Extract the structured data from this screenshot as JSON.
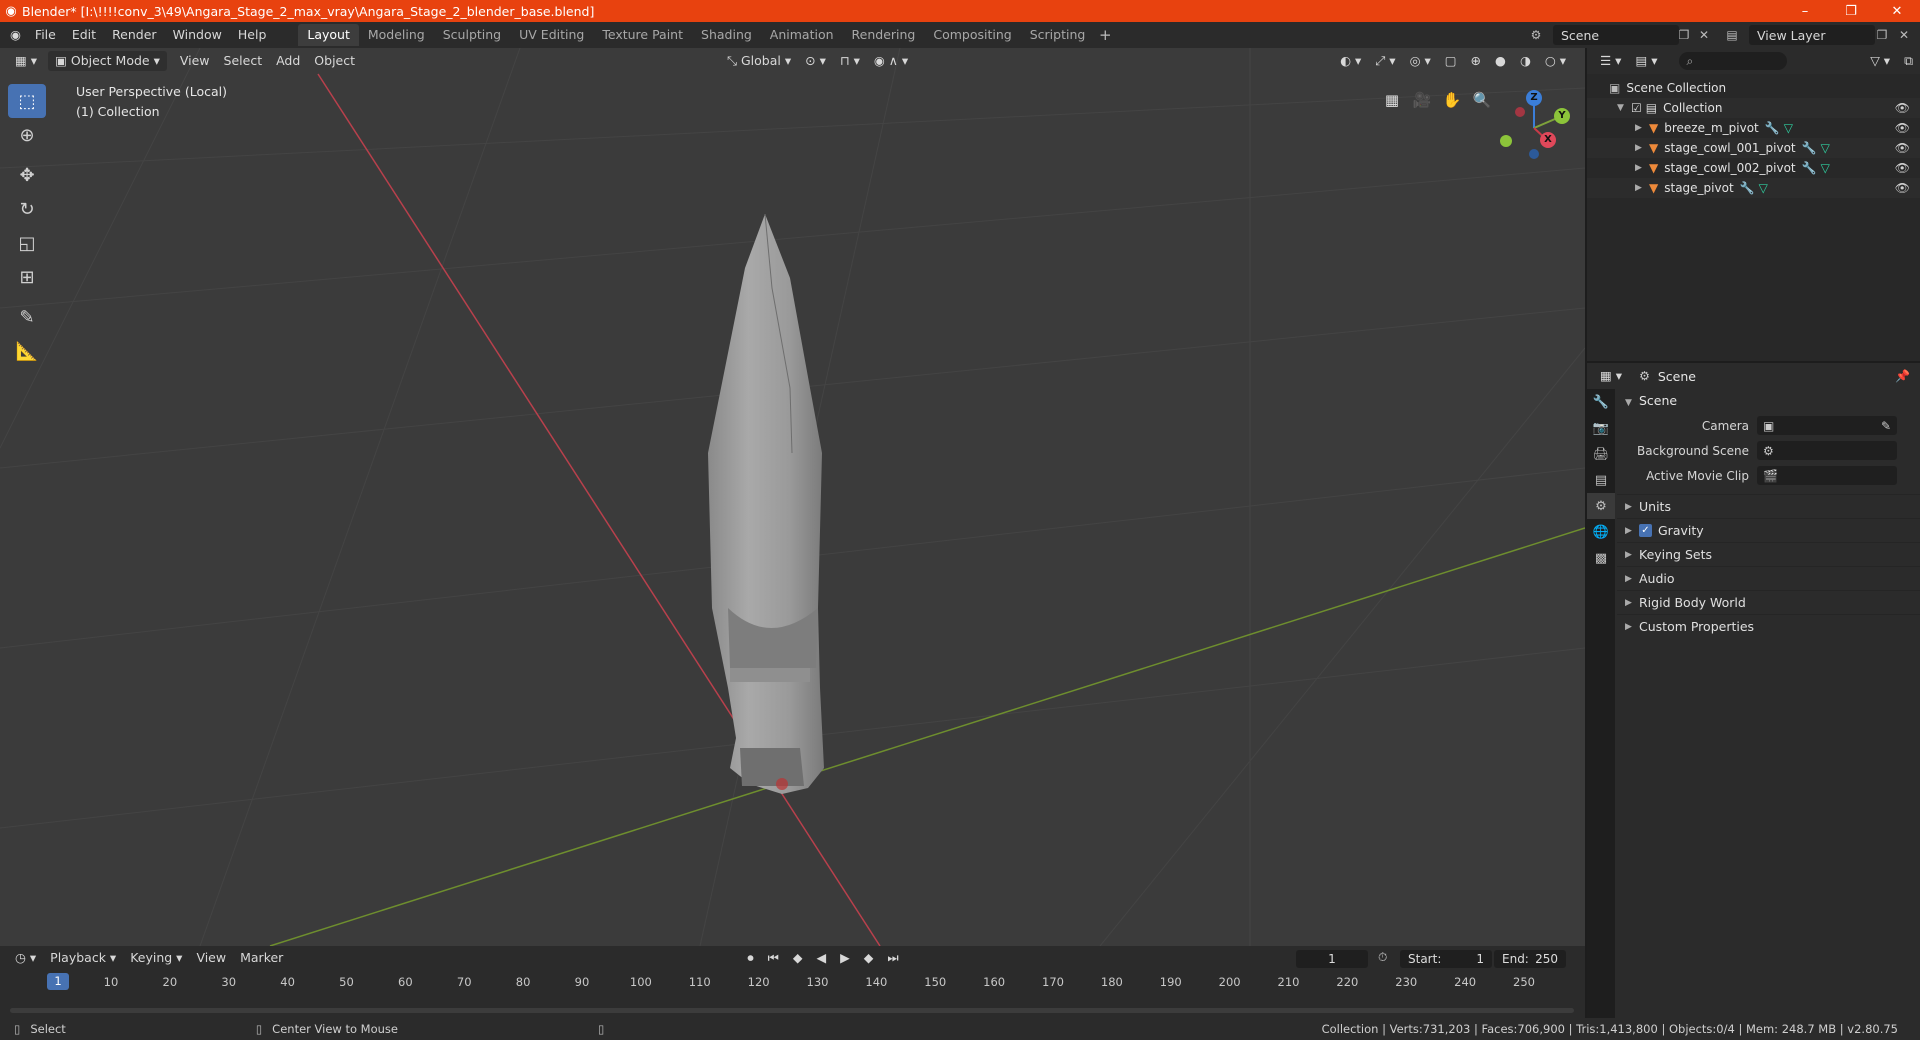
{
  "window": {
    "title": "Blender* [I:\\!!!!conv_3\\49\\Angara_Stage_2_max_vray\\Angara_Stage_2_blender_base.blend]",
    "minimize": "–",
    "maximize": "❐",
    "close": "✕"
  },
  "menu": [
    "File",
    "Edit",
    "Render",
    "Window",
    "Help"
  ],
  "workspaces": [
    "Layout",
    "Modeling",
    "Sculpting",
    "UV Editing",
    "Texture Paint",
    "Shading",
    "Animation",
    "Rendering",
    "Compositing",
    "Scripting"
  ],
  "active_workspace": "Layout",
  "scene_selector": "Scene",
  "view_layer_selector": "View Layer",
  "viewport": {
    "mode": "Object Mode",
    "menus": [
      "View",
      "Select",
      "Add",
      "Object"
    ],
    "transform_orientation": "Global",
    "info_line1": "User Perspective (Local)",
    "info_line2": "(1) Collection",
    "gizmo": {
      "z": "Z",
      "y": "Y",
      "x": "X"
    }
  },
  "outliner": {
    "root": "Scene Collection",
    "collection": "Collection",
    "objects": [
      "breeze_m_pivot",
      "stage_cowl_001_pivot",
      "stage_cowl_002_pivot",
      "stage_pivot"
    ]
  },
  "properties": {
    "header": "Scene",
    "panel": "Scene",
    "fields": [
      {
        "label": "Camera",
        "value": ""
      },
      {
        "label": "Background Scene",
        "value": ""
      },
      {
        "label": "Active Movie Clip",
        "value": ""
      }
    ],
    "subpanels": [
      "Units",
      "Gravity",
      "Keying Sets",
      "Audio",
      "Rigid Body World",
      "Custom Properties"
    ],
    "gravity_checked": true
  },
  "timeline": {
    "menus": [
      "Playback",
      "Keying",
      "View",
      "Marker"
    ],
    "current_frame": "1",
    "start_label": "Start:",
    "start": "1",
    "end_label": "End:",
    "end": "250",
    "ruler": [
      "1",
      "10",
      "20",
      "30",
      "40",
      "50",
      "60",
      "70",
      "80",
      "90",
      "100",
      "110",
      "120",
      "130",
      "140",
      "150",
      "160",
      "170",
      "180",
      "190",
      "200",
      "210",
      "220",
      "230",
      "240",
      "250"
    ]
  },
  "status": {
    "left": "Select",
    "middle": "Center View to Mouse",
    "stats": "Collection | Verts:731,203 | Faces:706,900 | Tris:1,413,800 | Objects:0/4 | Mem: 248.7 MB | v2.80.75"
  },
  "colors": {
    "titlebar": "#e8420f",
    "accent": "#4772b3",
    "x_axis": "#c83a48",
    "y_axis": "#7ea23b",
    "object_icon": "#ee8a3b"
  }
}
